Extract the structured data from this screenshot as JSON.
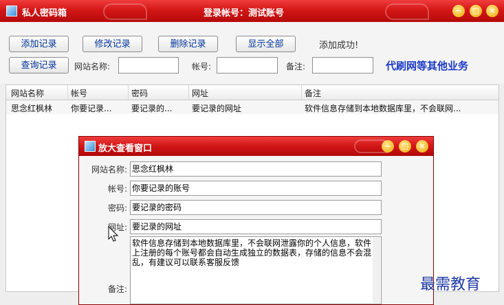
{
  "window": {
    "app_title": "私人密码箱",
    "center_title": "登录帐号：测试账号",
    "controls": {
      "minimize": "−",
      "maximize": "□",
      "close": "×"
    }
  },
  "toolbar": {
    "add_label": "添加记录",
    "edit_label": "修改记录",
    "delete_label": "删除记录",
    "show_all_label": "显示全部",
    "query_label": "查询记录",
    "status": "添加成功!",
    "site_label": "网站名称:",
    "account_label": "帐号:",
    "note_label": "备注:",
    "site_value": "",
    "account_value": "",
    "note_value": "",
    "ad_text": "代刷网等其他业务"
  },
  "table": {
    "headers": [
      "网站名称",
      "帐号",
      "密码",
      "网址",
      "备注"
    ],
    "rows": [
      [
        "思念红枫林",
        "你要记录...",
        "要记录的...",
        "要记录的网址",
        "软件信息存储到本地数据库里，不会联网..."
      ]
    ]
  },
  "popup": {
    "title": "放大查看窗口",
    "fields": [
      {
        "label": "网站名称:",
        "value": "思念红枫林"
      },
      {
        "label": "帐号:",
        "value": "你要记录的账号"
      },
      {
        "label": "密码:",
        "value": "要记录的密码"
      },
      {
        "label": "网址:",
        "value": "要记录的网址"
      }
    ],
    "note_label": "备注:",
    "note_value": "软件信息存储到本地数据库里，不会联网泄露你的个人信息，软件上注册的每个账号都会自动生成独立的数据表，存储的信息不会混乱，有建议可以联系客服反馈"
  },
  "watermark": "最需教育",
  "colors": {
    "title_red": "#d41717",
    "accent_blue": "#1b39c8"
  }
}
